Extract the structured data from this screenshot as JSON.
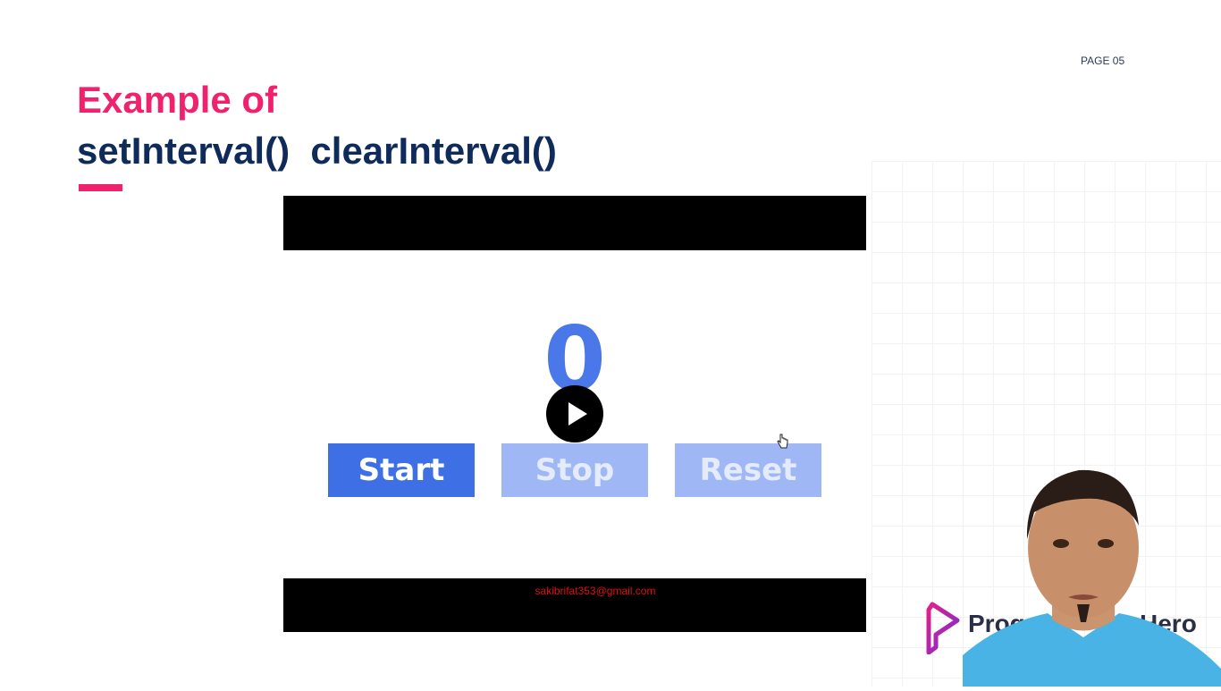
{
  "slide": {
    "page_label": "PAGE 05",
    "title_line1": "Example of",
    "title_line2": "setInterval()  clearInterval()"
  },
  "demo": {
    "counter_value": "0",
    "buttons": {
      "start": "Start",
      "stop": "Stop",
      "reset": "Reset"
    }
  },
  "overlay": {
    "email": "sakibrifat353@gmail.com",
    "play_icon": "play-icon"
  },
  "brand": {
    "name_visible_start": "Progra",
    "name_visible_end": "Hero"
  },
  "colors": {
    "accent_pink": "#f0226e",
    "title_navy": "#0f2b5b",
    "button_blue": "#3f6fe5",
    "button_disabled": "#9fb8f5",
    "counter_blue": "#4a78e8"
  }
}
